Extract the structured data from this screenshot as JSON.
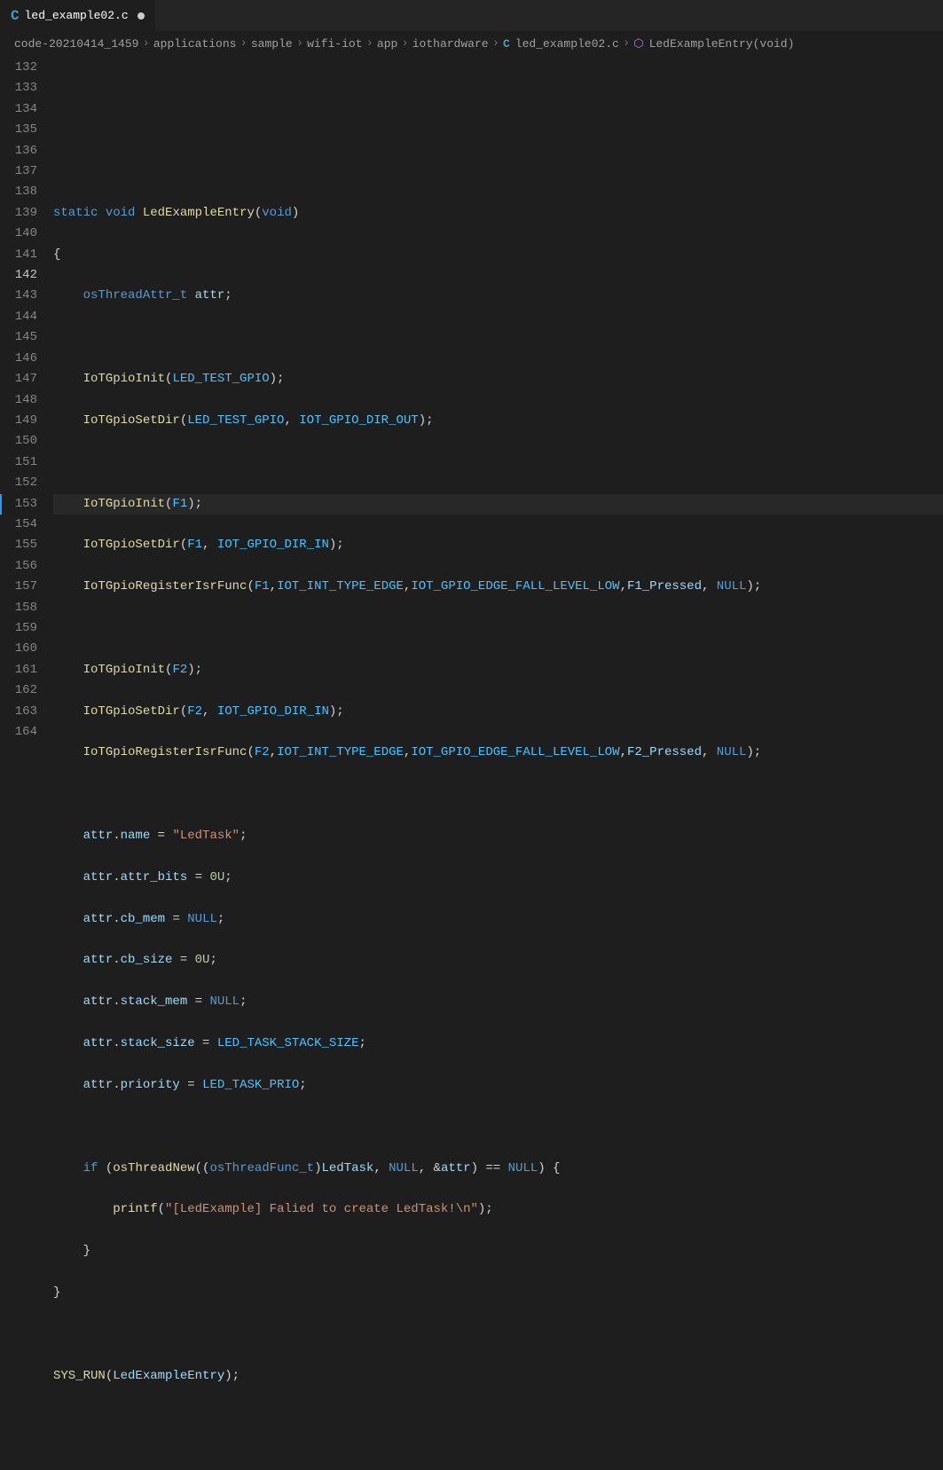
{
  "tab": {
    "icon_label": "C",
    "filename": "led_example02.c",
    "modified": true
  },
  "breadcrumb": {
    "items": [
      "code-20210414_1459",
      "applications",
      "sample",
      "wifi-iot",
      "app",
      "iothardware"
    ],
    "file_icon": "C",
    "file": "led_example02.c",
    "symbol_icon": "⬡",
    "symbol": "LedExampleEntry(void)"
  },
  "line_numbers": [
    "132",
    "133",
    "134",
    "135",
    "136",
    "137",
    "138",
    "139",
    "140",
    "141",
    "142",
    "143",
    "144",
    "145",
    "146",
    "147",
    "148",
    "149",
    "150",
    "151",
    "152",
    "153",
    "154",
    "155",
    "156",
    "157",
    "158",
    "159",
    "160",
    "161",
    "162",
    "163",
    "164"
  ],
  "active_line": "142",
  "code": {
    "l135": {
      "kw1": "static",
      "kw2": "void",
      "fn": "LedExampleEntry",
      "p1": "(",
      "type": "void",
      "p2": ")"
    },
    "l136": {
      "brace": "{"
    },
    "l137": {
      "type": "osThreadAttr_t",
      "var": "attr",
      "semi": ";"
    },
    "l139": {
      "fn": "IoTGpioInit",
      "p1": "(",
      "c": "LED_TEST_GPIO",
      "p2": ");"
    },
    "l140": {
      "fn": "IoTGpioSetDir",
      "p1": "(",
      "c1": "LED_TEST_GPIO",
      "comma": ", ",
      "c2": "IOT_GPIO_DIR_OUT",
      "p2": ");"
    },
    "l142": {
      "fn": "IoTGpioInit",
      "p1": "(",
      "c": "F1",
      "p2": ");"
    },
    "l143": {
      "fn": "IoTGpioSetDir",
      "p1": "(",
      "c1": "F1",
      "comma": ", ",
      "c2": "IOT_GPIO_DIR_IN",
      "p2": ");"
    },
    "l144": {
      "fn": "IoTGpioRegisterIsrFunc",
      "p1": "(",
      "c1": "F1",
      "c2": "IOT_INT_TYPE_EDGE",
      "c3": "IOT_GPIO_EDGE_FALL_LEVEL_LOW",
      "c4": "F1_Pressed",
      "comma": ", ",
      "null": "NULL",
      "p2": ");"
    },
    "l146": {
      "fn": "IoTGpioInit",
      "p1": "(",
      "c": "F2",
      "p2": ");"
    },
    "l147": {
      "fn": "IoTGpioSetDir",
      "p1": "(",
      "c1": "F2",
      "comma": ", ",
      "c2": "IOT_GPIO_DIR_IN",
      "p2": ");"
    },
    "l148": {
      "fn": "IoTGpioRegisterIsrFunc",
      "p1": "(",
      "c1": "F2",
      "c2": "IOT_INT_TYPE_EDGE",
      "c3": "IOT_GPIO_EDGE_FALL_LEVEL_LOW",
      "c4": "F2_Pressed",
      "comma": ", ",
      "null": "NULL",
      "p2": ");"
    },
    "l150": {
      "v": "attr",
      "dot": ".",
      "f": "name",
      "eq": " = ",
      "str": "\"LedTask\"",
      "semi": ";"
    },
    "l151": {
      "v": "attr",
      "dot": ".",
      "f": "attr_bits",
      "eq": " = ",
      "val": "0U",
      "semi": ";"
    },
    "l152": {
      "v": "attr",
      "dot": ".",
      "f": "cb_mem",
      "eq": " = ",
      "val": "NULL",
      "semi": ";"
    },
    "l153": {
      "v": "attr",
      "dot": ".",
      "f": "cb_size",
      "eq": " = ",
      "val": "0U",
      "semi": ";"
    },
    "l154": {
      "v": "attr",
      "dot": ".",
      "f": "stack_mem",
      "eq": " = ",
      "val": "NULL",
      "semi": ";"
    },
    "l155": {
      "v": "attr",
      "dot": ".",
      "f": "stack_size",
      "eq": " = ",
      "val": "LED_TASK_STACK_SIZE",
      "semi": ";"
    },
    "l156": {
      "v": "attr",
      "dot": ".",
      "f": "priority",
      "eq": " = ",
      "val": "LED_TASK_PRIO",
      "semi": ";"
    },
    "l158": {
      "kw": "if",
      "p1": " (",
      "fn": "osThreadNew",
      "p2": "((",
      "type": "osThreadFunc_t",
      "p3": ")",
      "var": "LedTask",
      "c1": ", ",
      "null1": "NULL",
      "c2": ", &",
      "v2": "attr",
      "p4": ") == ",
      "null2": "NULL",
      "p5": ") {"
    },
    "l159": {
      "fn": "printf",
      "p1": "(",
      "str": "\"[LedExample] Falied to create LedTask!\\n\"",
      "p2": ");"
    },
    "l160": {
      "brace": "}"
    },
    "l161": {
      "brace": "}"
    },
    "l163": {
      "fn": "SYS_RUN",
      "p1": "(",
      "var": "LedExampleEntry",
      "p2": ");"
    }
  }
}
